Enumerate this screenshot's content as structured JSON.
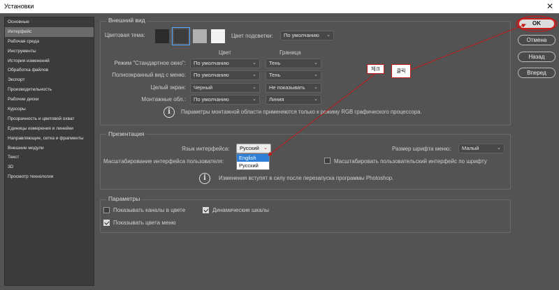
{
  "window": {
    "title": "Установки",
    "close_glyph": "✕"
  },
  "sidebar": {
    "items": [
      {
        "label": "Основные"
      },
      {
        "label": "Интерфейс"
      },
      {
        "label": "Рабочая среда"
      },
      {
        "label": "Инструменты"
      },
      {
        "label": "История изменений"
      },
      {
        "label": "Обработка файлов"
      },
      {
        "label": "Экспорт"
      },
      {
        "label": "Производительность"
      },
      {
        "label": "Рабочие диски"
      },
      {
        "label": "Курсоры"
      },
      {
        "label": "Прозрачность и цветовой охват"
      },
      {
        "label": "Единицы измерения и линейки"
      },
      {
        "label": "Направляющие, сетка и фрагменты"
      },
      {
        "label": "Внешние модули"
      },
      {
        "label": "Текст"
      },
      {
        "label": "3D"
      },
      {
        "label": "Просмотр технологии"
      }
    ],
    "active_index": 1
  },
  "appearance": {
    "legend": "Внешний вид",
    "color_theme_label": "Цветовая тема:",
    "swatch_colors": [
      "#2b2b2b",
      "#3c3c3c",
      "#b0b0b0",
      "#f2f2f2"
    ],
    "highlight_label": "Цвет подсветки:",
    "highlight_value": "По умолчанию",
    "col_color": "Цвет",
    "col_border": "Граница",
    "rows": [
      {
        "label": "Режим \"Стандартное окно\":",
        "color": "По умолчанию",
        "border": "Тень"
      },
      {
        "label": "Полноэкранный вид с меню:",
        "color": "По умолчанию",
        "border": "Тень"
      },
      {
        "label": "Целый экран:",
        "color": "Черный",
        "border": "Не показывать"
      },
      {
        "label": "Монтажные обл.:",
        "color": "По умолчанию",
        "border": "Линия"
      }
    ],
    "info_text": "Параметры монтажной области применяются только к режиму RGB графического процессора."
  },
  "presentation": {
    "legend": "Презентация",
    "ui_language_label": "Язык интерфейса:",
    "ui_language_value": "Русский",
    "language_options": [
      "English",
      "Русский"
    ],
    "highlighted_option": 0,
    "menu_font_size_label": "Размер шрифта меню:",
    "menu_font_size_value": "Малый",
    "ui_scale_label": "Масштабирование интерфейса пользователя:",
    "scale_by_font_label": "Масштабировать пользовательский интерфейс по шрифту",
    "scale_by_font_checked": false,
    "info_text": "Изменения вступят в силу после перезапуска программы Photoshop."
  },
  "options": {
    "legend": "Параметры",
    "show_channels_label": "Показывать каналы в цвете",
    "show_channels_checked": false,
    "dynamic_sliders_label": "Динамические шкалы",
    "dynamic_sliders_checked": true,
    "show_menu_colors_label": "Показывать цвета меню",
    "show_menu_colors_checked": true
  },
  "buttons": {
    "ok": "OK",
    "cancel": "Отмена",
    "back": "Назад",
    "forward": "Вперед"
  },
  "annotations": {
    "check": "체크",
    "click": "클릭",
    "color": "#c21818"
  },
  "icons": {
    "info": "info-icon",
    "chevron": "chevron-down-icon",
    "close": "close-icon"
  }
}
